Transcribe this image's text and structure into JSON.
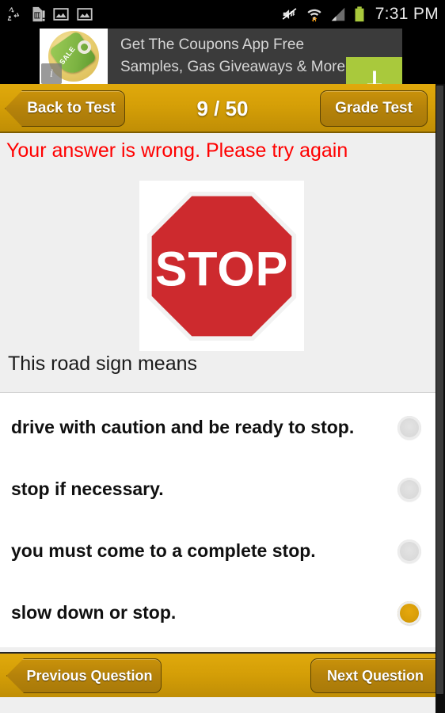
{
  "statusbar": {
    "time": "7:31 PM",
    "left_icons": [
      "recycle-icon",
      "sd-card-warning-icon",
      "image-icon",
      "image-icon"
    ],
    "right_icons": [
      "mute-icon",
      "wifi-icon",
      "cellular-signal-icon",
      "battery-icon"
    ],
    "battery_color": "#a9c93c",
    "background": "#000000"
  },
  "ad": {
    "line1": "Get The Coupons App Free",
    "line2": "Samples, Gas Giveaways & More",
    "tag_label": "SALE",
    "info_badge": "i",
    "cta_icon": "download-icon",
    "cta_color": "#a9c93c",
    "background": "#3b3b3b"
  },
  "toolbar": {
    "back_label": "Back to Test",
    "grade_label": "Grade Test",
    "counter": "9 / 50",
    "current_question": 9,
    "total_questions": 50,
    "accent": "#d59f07"
  },
  "feedback": {
    "message": "Your answer is wrong. Please try again",
    "color": "#ff0000"
  },
  "question": {
    "prompt": "This road sign means",
    "image": "stop-sign-image",
    "sign_text": "STOP",
    "sign_color": "#ce2b2b"
  },
  "answers": [
    {
      "label": "drive with caution and be ready to stop.",
      "selected": false
    },
    {
      "label": "stop if necessary.",
      "selected": false
    },
    {
      "label": "you must come to a complete stop.",
      "selected": false
    },
    {
      "label": "slow down or stop.",
      "selected": true
    }
  ],
  "bottombar": {
    "previous_label": "Previous Question",
    "next_label": "Next Question"
  }
}
